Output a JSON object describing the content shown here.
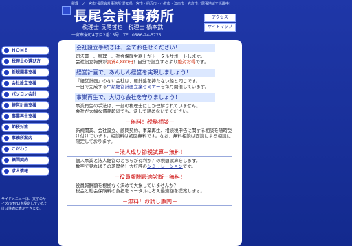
{
  "header": {
    "tagline": "税理士ノ一宮市[長尾会計事務所]愛知県一宮市・稲沢市・小牧市・江南市・岩倉市と尾張地域で活躍中！",
    "title": "長尾会計事務所",
    "names": "税理士 長尾哲也　税理士 橋本武",
    "address": "一宮市栄町4丁目2番15号　TEL 0586-24-5775",
    "access": "アクセス",
    "sitemap": "サイトマップ"
  },
  "sidebar": {
    "items": [
      "ＨＯＭＥ",
      "税理士の選び方",
      "新規開業支援",
      "会社設立支援",
      "パソコン会計",
      "経営計画支援",
      "事業再生支援",
      "節税対策",
      "事務所案内",
      "こだわり",
      "顧問契約",
      "求人情報"
    ],
    "note": "サイドメニューは、文字のサイズ(S/M/L)を設定していただけば快適に表示できます。"
  },
  "main": {
    "s1_title": "会社設立手続きは、全てお任せください！",
    "s1_body_a": "司法書士、税理士、社会保険労務士がトータルサポートします。",
    "s1_body_b": "会社設立報酬が",
    "s1_body_hl1": "実質4,800円",
    "s1_body_c": "！自分で設立するより",
    "s1_body_hl2": "絶対お得",
    "s1_body_d": "です。",
    "s2_title": "経営計画で、あんしん経営を実現しましょう！",
    "s2_body_a": "『経営計画』のない会社は、羅針盤を持たない船と同じです。",
    "s2_body_b": "一日で完成する",
    "s2_body_link": "中期経営計画立案セミナー",
    "s2_body_c": "を毎月開催しています。",
    "s3_title": "事業再生で、大切な会社を守りましょう！",
    "s3_body_a": "事業再生の手法は、一部の税理士にしか理解されていません。",
    "s3_body_b": "会社が大幅な債務超過でも、決して諦めないでください。",
    "d1_title": "－無料！税務相談－",
    "d1_body": "新規開業、会社設立、顧問契約、事業再生、相続税申告に関する相談を随時受け付けています。相談料は初回無料です。なお、無料相談は面談による相談に限定しております。",
    "d2_title": "－法人成り節税試算－無料！",
    "d2_body_a": "個人事業と法人経営のどちらが有利か？の税額試算をします。",
    "d2_body_b": "数字で見ればその差歴然！大好評の",
    "d2_body_link": "シミュレーション",
    "d2_body_c": "です。",
    "d3_title": "－役員報酬最適診断－無料！",
    "d3_body_a": "役員報酬額を根拠なく決めて大損していませんか？",
    "d3_body_b": "税金と社会保険料の負担をトータルに考え最適額を提案します。",
    "d4_title": "－無料！お試し顧問－"
  }
}
